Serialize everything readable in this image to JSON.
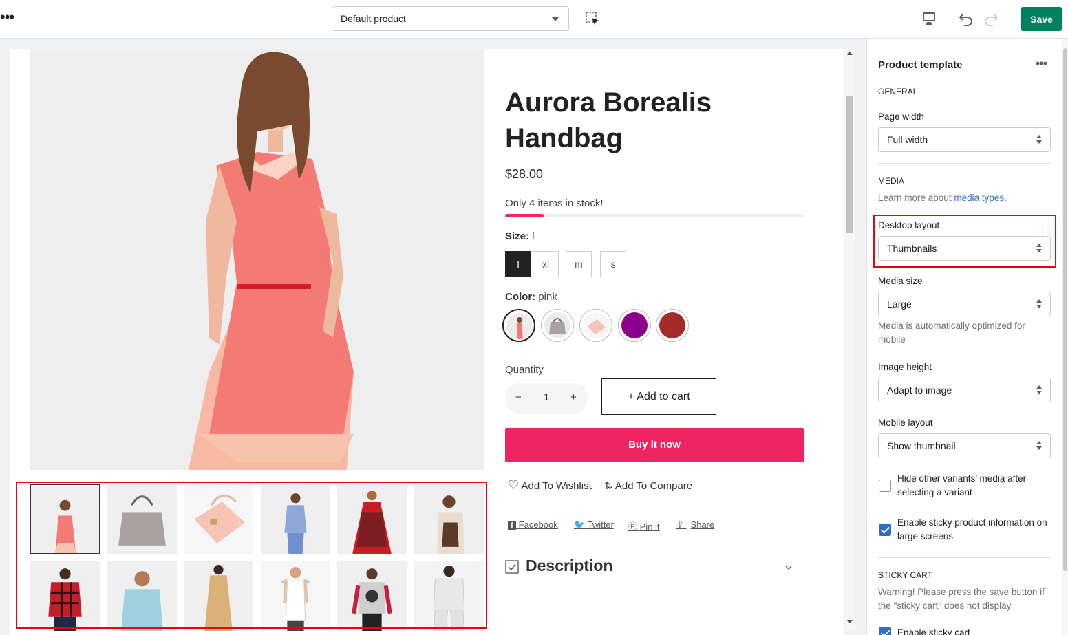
{
  "topbar": {
    "template_select": "Default product",
    "save_label": "Save"
  },
  "product": {
    "title": "Aurora Borealis Handbag",
    "price": "$28.00",
    "stock_text": "Only 4 items in stock!",
    "stock_fraction": 0.13,
    "size_label": "Size:",
    "size_value": "l",
    "sizes": [
      "l",
      "xl",
      "m",
      "s"
    ],
    "color_label": "Color:",
    "color_value": "pink",
    "swatches": [
      "dress-photo",
      "gray-bag-photo",
      "pink-bag-photo",
      "#8b008b",
      "#a52a2a"
    ],
    "quantity_label": "Quantity",
    "quantity_value": "1",
    "qty_minus": "−",
    "qty_plus": "+",
    "add_to_cart": "+ Add to cart",
    "buy_now": "Buy it now",
    "wishlist": "Add To Wishlist",
    "compare": "Add To Compare",
    "social": [
      "Facebook",
      "Twitter",
      "Pin it",
      "Share"
    ],
    "description": "Description"
  },
  "thumbnails": [
    "pink dress",
    "gray handbag",
    "pink handbag",
    "blue shirt",
    "red dress",
    "tote bag",
    "red plaid shirt",
    "blue sweater",
    "beige coat",
    "white tank",
    "graphic sweatshirt",
    "white tracksuit"
  ],
  "sidebar": {
    "title": "Product template",
    "general": "GENERAL",
    "page_width_label": "Page width",
    "page_width_value": "Full width",
    "media": "MEDIA",
    "media_help": "Learn more about ",
    "media_link": "media types.",
    "desktop_layout_label": "Desktop layout",
    "desktop_layout_value": "Thumbnails",
    "media_size_label": "Media size",
    "media_size_value": "Large",
    "media_size_help": "Media is automatically optimized for mobile",
    "image_height_label": "Image height",
    "image_height_value": "Adapt to image",
    "mobile_layout_label": "Mobile layout",
    "mobile_layout_value": "Show thumbnail",
    "hide_variants_label": "Hide other variants’ media after selecting a variant",
    "hide_variants_checked": false,
    "sticky_info_label": "Enable sticky product information on large screens",
    "sticky_info_checked": true,
    "sticky_cart": "STICKY CART",
    "sticky_cart_warning": "Warning! Please press the save button if the \"sticky cart\" does not display",
    "enable_sticky_cart_label": "Enable sticky cart",
    "enable_sticky_cart_checked": true
  },
  "colors": {
    "save": "#008060",
    "buy_now": "#ee2562",
    "highlight": "#e30613",
    "link": "#2c6ecb"
  }
}
